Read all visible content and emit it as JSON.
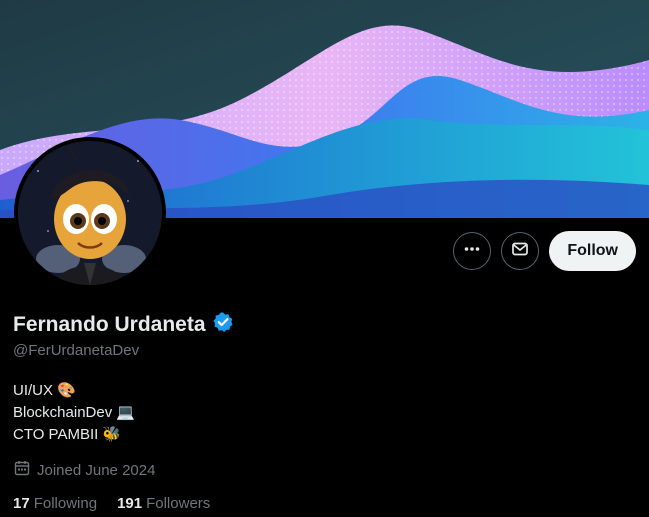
{
  "profile": {
    "display_name": "Fernando Urdaneta",
    "handle": "@FerUrdanetaDev",
    "verified_icon": "verified-badge-icon",
    "bio": [
      {
        "text": "UI/UX",
        "emoji": "🎨"
      },
      {
        "text": "BlockchainDev",
        "emoji": "💻"
      },
      {
        "text": "CTO PAMBII",
        "emoji": "🐝"
      }
    ],
    "joined": "Joined June 2024",
    "following_count": "17",
    "following_label": "Following",
    "followers_count": "191",
    "followers_label": "Followers"
  },
  "actions": {
    "more_icon": "more-horizontal-icon",
    "message_icon": "envelope-icon",
    "follow_label": "Follow"
  },
  "colors": {
    "background": "#000000",
    "text_primary": "#e7e9ea",
    "text_secondary": "#71767b",
    "verified_blue": "#1d9bf0",
    "follow_button_bg": "#eff3f4"
  }
}
